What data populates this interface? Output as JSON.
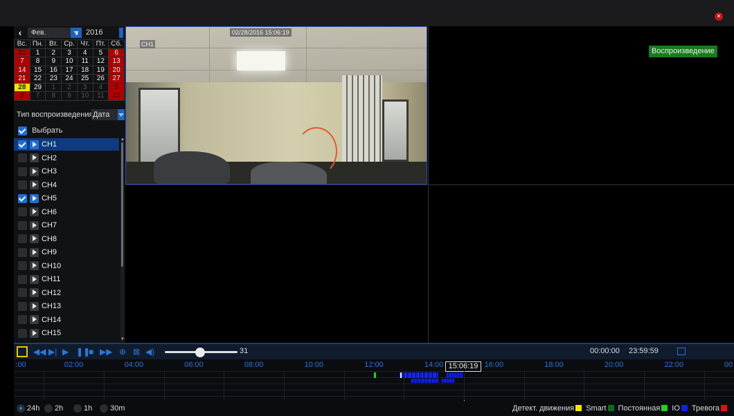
{
  "window": {
    "close_icon": "close-icon"
  },
  "calendar": {
    "month": "Фев.",
    "year": "2016",
    "weekdays": [
      "Вс.",
      "Пн.",
      "Вт.",
      "Ср.",
      "Чт.",
      "Пт.",
      "Сб."
    ],
    "weeks": [
      [
        "31",
        "1",
        "2",
        "3",
        "4",
        "5",
        "6"
      ],
      [
        "7",
        "8",
        "9",
        "10",
        "11",
        "12",
        "13"
      ],
      [
        "14",
        "15",
        "16",
        "17",
        "18",
        "19",
        "20"
      ],
      [
        "21",
        "22",
        "23",
        "24",
        "25",
        "26",
        "27"
      ],
      [
        "28",
        "29",
        "1",
        "2",
        "3",
        "4",
        "5"
      ],
      [
        "6",
        "7",
        "8",
        "9",
        "10",
        "11",
        "12"
      ]
    ],
    "selected_day": "28"
  },
  "playback_type": {
    "label": "Тип воспроизведения",
    "value": "Дата"
  },
  "select_all": {
    "label": "Выбрать",
    "checked": true
  },
  "channels": [
    {
      "name": "CH1",
      "checked": true,
      "active": true
    },
    {
      "name": "CH2",
      "checked": false
    },
    {
      "name": "CH3",
      "checked": false
    },
    {
      "name": "CH4",
      "checked": false
    },
    {
      "name": "CH5",
      "checked": true
    },
    {
      "name": "CH6",
      "checked": false
    },
    {
      "name": "CH7",
      "checked": false
    },
    {
      "name": "CH8",
      "checked": false
    },
    {
      "name": "CH9",
      "checked": false
    },
    {
      "name": "CH10",
      "checked": false
    },
    {
      "name": "CH11",
      "checked": false
    },
    {
      "name": "CH12",
      "checked": false
    },
    {
      "name": "CH13",
      "checked": false
    },
    {
      "name": "CH14",
      "checked": false
    },
    {
      "name": "CH15",
      "checked": false
    }
  ],
  "video": {
    "osd_timestamp": "02/28/2016 15:06:19",
    "osd_channel": "CH1",
    "playback_button": "Воспроизведение"
  },
  "controls": {
    "volume": "31",
    "start_time": "00:00:00",
    "end_time": "23:59:59",
    "icons": [
      "snapshot-icon",
      "rewind-icon",
      "step-forward-icon",
      "play-icon",
      "pause-icon",
      "stop-icon",
      "fast-forward-icon",
      "zoom-icon",
      "clip-icon",
      "volume-icon"
    ]
  },
  "timeline": {
    "hours": [
      ":00",
      "02:00",
      "04:00",
      "06:00",
      "08:00",
      "10:00",
      "12:00",
      "14:00",
      "16:00",
      "18:00",
      "20:00",
      "22:00",
      "00"
    ],
    "cursor_time": "15:06:19"
  },
  "zoom_options": [
    {
      "label": "24h",
      "selected": true
    },
    {
      "label": "2h",
      "selected": false
    },
    {
      "label": "1h",
      "selected": false
    },
    {
      "label": "30m",
      "selected": false
    }
  ],
  "legend": [
    {
      "label": "Детект. движения",
      "color": "#f5e600"
    },
    {
      "label": "Smart",
      "color": "#0f6b1a"
    },
    {
      "label": "Постоянная",
      "color": "#1ed41e"
    },
    {
      "label": "IO",
      "color": "#1020e8"
    },
    {
      "label": "Тревога",
      "color": "#e31010"
    }
  ]
}
